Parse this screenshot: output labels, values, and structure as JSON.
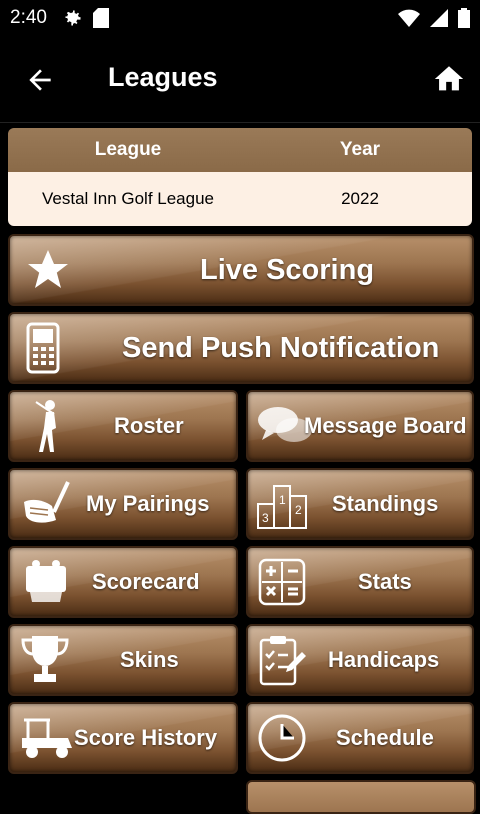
{
  "status_bar": {
    "time": "2:40"
  },
  "app_bar": {
    "title": "Leagues"
  },
  "league_table": {
    "headers": {
      "league": "League",
      "year": "Year"
    },
    "rows": [
      {
        "league": "Vestal Inn Golf League",
        "year": "2022"
      }
    ]
  },
  "buttons": {
    "live_scoring": "Live Scoring",
    "send_push": "Send Push Notification",
    "roster": "Roster",
    "message_board": "Message Board",
    "my_pairings": "My Pairings",
    "standings": "Standings",
    "scorecard": "Scorecard",
    "stats": "Stats",
    "skins": "Skins",
    "handicaps": "Handicaps",
    "score_history": "Score History",
    "schedule": "Schedule"
  },
  "icons": {
    "status": [
      "gear-icon",
      "sd-card-icon",
      "wifi-icon",
      "cell-signal-icon",
      "battery-icon"
    ],
    "app_bar": [
      "back-arrow-icon",
      "home-icon"
    ]
  },
  "colors": {
    "button_brown": "#9d7550",
    "table_header": "#8a6a48",
    "table_row": "#fdf0e4"
  }
}
